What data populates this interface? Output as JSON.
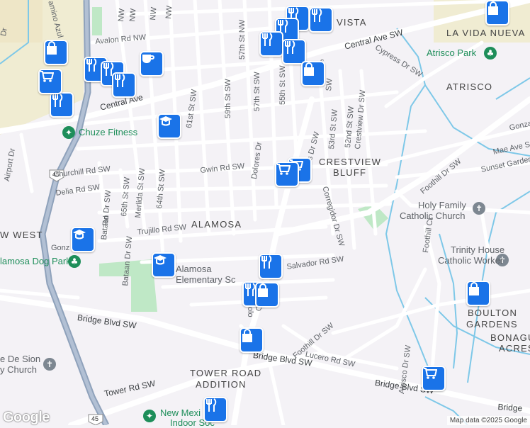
{
  "neighborhoods": {
    "vista": "VISTA",
    "la_vida_nueva": "LA VIDA NUEVA",
    "atrisco": "ATRISCO",
    "crestview_bluff_1": "CRESTVIEW",
    "crestview_bluff_2": "BLUFF",
    "alamosa": "ALAMOSA",
    "west": "W WEST",
    "boulton_gardens_1": "BOULTON",
    "boulton_gardens_2": "GARDENS",
    "bonagu_1": "BONAGU",
    "bonagu_2": "ACRES",
    "tower_road_1": "TOWER ROAD",
    "tower_road_2": "ADDITION"
  },
  "streets": {
    "central_ave_sw": "Central Ave SW",
    "central_ave": "Central Ave",
    "avalon_rd": "Avalon Rd NW",
    "cypress": "Cypress Dr SW",
    "churchill": "Churchill Rd SW",
    "gwin": "Gwin Rd SW",
    "delia": "Delia Rd SW",
    "trujillo": "Trujillo Rd SW",
    "salvador": "Salvador Rd SW",
    "bridge_1": "Bridge Blvd SW",
    "bridge_2": "Bridge Blvd SW",
    "bridge_3": "Bridge Blvd SW",
    "bridge_4": "Bridge",
    "tower_rd": "Tower Rd SW",
    "lucero": "Lucero Rd SW",
    "foothill_1": "Foothill Dr SW",
    "foothill_2": "Foothill Dr SW",
    "foothill_ct": "Foothill Ct",
    "atrisco_dr": "Atrisco Dr SW",
    "mae_ave": "Mae Ave S",
    "sunset_gardens": "Sunset Garden",
    "gonza": "Gonza",
    "gonz": "Gonz",
    "st_57_n": "57th St NW",
    "st_57": "57th St SW",
    "st_59": "59th St SW",
    "st_61": "61st St SW",
    "st_55": "55th St SW",
    "st_53": "53rd St SW",
    "st_52": "52nd St SW",
    "st_64": "64th St SW",
    "st_65": "65th St SW",
    "crestview_dr": "Crestview Dr SW",
    "corregidor": "Corregidor Dr SW",
    "dolores": "Dolores Dr",
    "dolores_2": "Dolo",
    "old": "Old",
    "moors": "oors Dr SW",
    "merlida": "Merlida St SW",
    "bataan_1": "Bataan Dr SW",
    "bataan_2": "Bataan Dr SW",
    "airport": "Airport Dr",
    "amino_azul": "amino Azul NW",
    "s_sw": "s",
    "sw": "SW",
    "dr_top": "Dr",
    "rd": "Rd",
    "nw_1": "NW",
    "nw_2": "NW",
    "nw_3": "NW",
    "nw_4": "NW",
    "route": "45"
  },
  "places": {
    "chuze": "Chuze Fitness",
    "atrisco_park": "Atrisco Park",
    "holy_family_1": "Holy Family",
    "holy_family_2": "Catholic Church",
    "trinity_1": "Trinity House",
    "trinity_2": "Catholic Worker",
    "alamosa_dog": "lamosa Dog Park",
    "alamosa_elem": "Alamosa",
    "alamosa_elem_2": "Elementary Sc",
    "de_sion_1": "e De Sion",
    "de_sion_2": "y Church",
    "new_mex_1": "New Mexi",
    "new_mex_2": "Indoor Soc"
  },
  "attribution": "Map data ©2025 Google",
  "logo": "Google",
  "colors": {
    "pin": "#1a73e8",
    "water": "#7ec8e8",
    "park": "#bfe8c6",
    "desert": "#f0ecd2",
    "highway": "#90a4be",
    "road": "#ffffff",
    "poi_green": "#1e8e5a",
    "poi_gray": "#7d8791"
  },
  "pins": [
    {
      "icon": "restaurant-icon"
    },
    {
      "icon": "restaurant-icon"
    },
    {
      "icon": "restaurant-icon"
    },
    {
      "icon": "restaurant-icon"
    },
    {
      "icon": "restaurant-icon"
    },
    {
      "icon": "restaurant-icon"
    },
    {
      "icon": "restaurant-icon"
    },
    {
      "icon": "restaurant-icon"
    },
    {
      "icon": "restaurant-icon"
    },
    {
      "icon": "restaurant-icon"
    },
    {
      "icon": "restaurant-icon"
    },
    {
      "icon": "restaurant-icon"
    },
    {
      "icon": "shopping-bag-icon"
    },
    {
      "icon": "shopping-bag-icon"
    },
    {
      "icon": "shopping-bag-icon"
    },
    {
      "icon": "shopping-bag-icon"
    },
    {
      "icon": "shopping-bag-icon"
    },
    {
      "icon": "shopping-bag-icon"
    },
    {
      "icon": "shopping-cart-icon"
    },
    {
      "icon": "shopping-cart-icon"
    },
    {
      "icon": "shopping-cart-icon"
    },
    {
      "icon": "shopping-cart-icon"
    },
    {
      "icon": "school-icon"
    },
    {
      "icon": "school-icon"
    },
    {
      "icon": "school-icon"
    },
    {
      "icon": "coffee-icon"
    }
  ]
}
